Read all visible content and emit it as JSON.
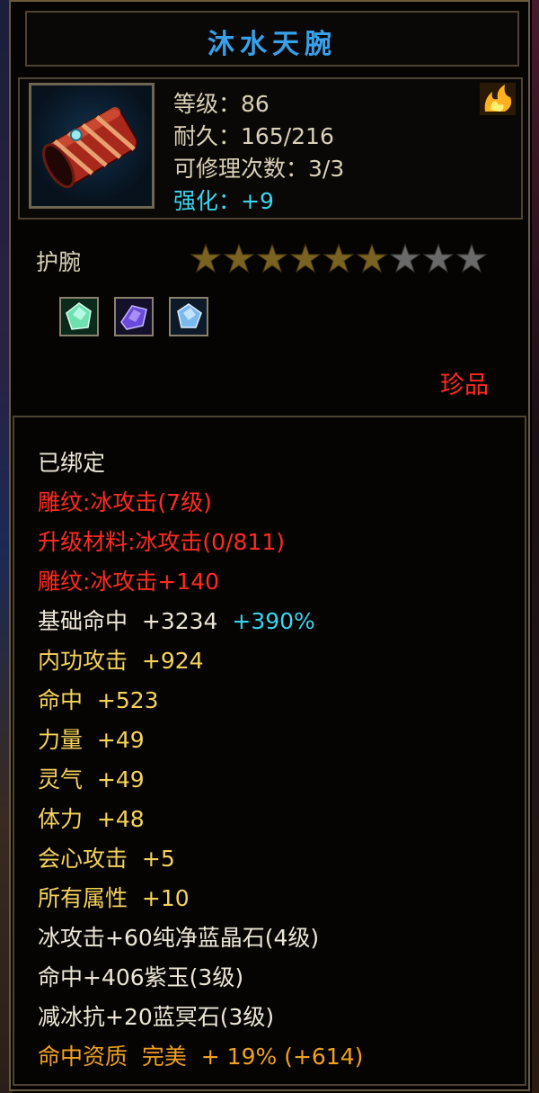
{
  "item": {
    "name": "沐水天腕",
    "stats": {
      "level": "等级：86",
      "durability": "耐久：165/216",
      "repairs": "可修理次数：3/3",
      "enhance": "强化：+9"
    },
    "type": "护腕",
    "stars": {
      "total": 9,
      "filled": 6
    },
    "gems": [
      "green-gem-icon",
      "purple-gem-icon",
      "blue-gem-icon"
    ],
    "quality": "珍品"
  },
  "attributes": {
    "bound": "已绑定",
    "engrave1": "雕纹:冰攻击(7级)",
    "upgrade_material": "升级材料:冰攻击(0/811)",
    "engrave2": "雕纹:冰攻击+140",
    "base_hit": "基础命中  +3234",
    "base_hit_bonus": "+390%",
    "inner_attack": "内功攻击  +924",
    "hit": "命中  +523",
    "strength": "力量  +49",
    "spirit": "灵气  +49",
    "stamina": "体力  +48",
    "crit": "会心攻击  +5",
    "all_attr": "所有属性  +10",
    "gem1": "冰攻击+60纯净蓝晶石(4级)",
    "gem2": "命中+406紫玉(3级)",
    "gem3": "减冰抗+20蓝冥石(3级)",
    "aptitude": "命中资质  完美  + 19% (+614)"
  },
  "colors": {
    "title": "#38a0ea",
    "red": "#ff2b1f",
    "yellow": "#f4d25a",
    "orange": "#f0a020",
    "cyan": "#39d4ee"
  }
}
